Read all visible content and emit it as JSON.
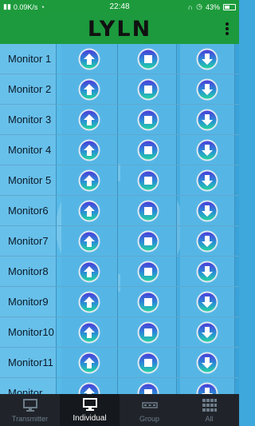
{
  "status": {
    "speed": "0.09K/s",
    "time": "22:48",
    "battery": "43%"
  },
  "app": {
    "title": "LYLN"
  },
  "monitors": [
    {
      "label": "Monitor 1"
    },
    {
      "label": "Monitor 2"
    },
    {
      "label": "Monitor 3"
    },
    {
      "label": "Monitor 4"
    },
    {
      "label": "Monitor 5"
    },
    {
      "label": "Monitor6"
    },
    {
      "label": "Monitor7"
    },
    {
      "label": "Monitor8"
    },
    {
      "label": "Monitor9"
    },
    {
      "label": "Monitor10"
    },
    {
      "label": "Monitor11"
    },
    {
      "label": "Monitor"
    }
  ],
  "tabs": [
    {
      "label": "Transmitter",
      "icon": "monitor-icon",
      "active": false
    },
    {
      "label": "Individual",
      "icon": "monitor-icon",
      "active": true
    },
    {
      "label": "Group",
      "icon": "group-icon",
      "active": false
    },
    {
      "label": "All",
      "icon": "grid-icon",
      "active": false
    }
  ],
  "colors": {
    "accent": "#1c9a3d",
    "grid": "#55b6e5",
    "tabbar": "#20242a"
  }
}
